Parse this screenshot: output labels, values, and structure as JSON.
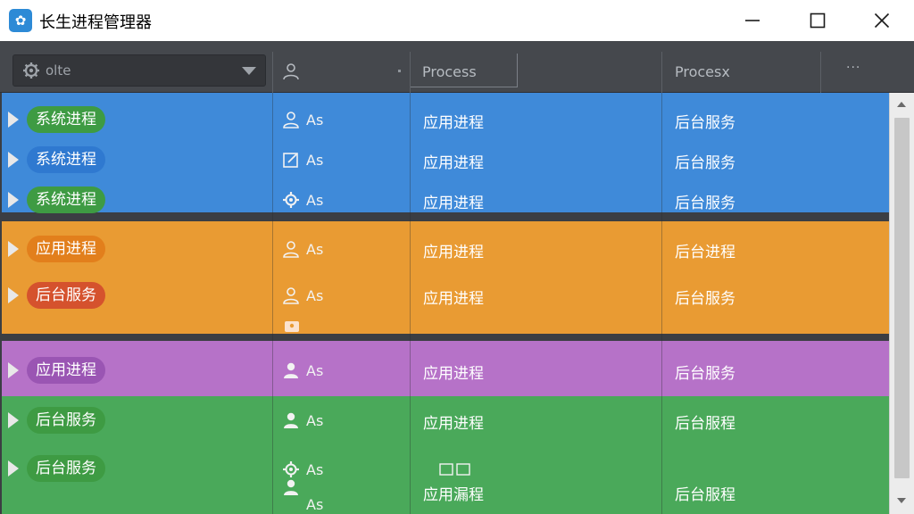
{
  "window": {
    "title": "长生进程管理器",
    "icon": "flower-app-icon",
    "accent": "#2d8ad6"
  },
  "header": {
    "filter_value": "olte",
    "process_label": "Process",
    "procesx_label": "Procesx",
    "more_label": "···"
  },
  "colors": {
    "blue_band": "#3f8ad9",
    "orange_band": "#e99b33",
    "purple_band": "#b672c8",
    "green_band": "#4aa95a",
    "pill_green": "#3e9b43",
    "pill_blue": "#2f79d0",
    "pill_orange": "#e27f1c",
    "pill_red": "#d5522d",
    "pill_purple": "#9a55b3"
  },
  "rows": [
    {
      "tag": "系统进程",
      "user_icon": "user-badge-icon",
      "user": "As",
      "col1": "应用进程",
      "col2": "后台服务"
    },
    {
      "tag": "系统进程",
      "user_icon": "edit-icon",
      "user": "As",
      "col1": "应用进程",
      "col2": "后台服务"
    },
    {
      "tag": "系统进程",
      "user_icon": "gear-icon",
      "user": "As",
      "col1": "应用进程",
      "col2": "后台服务"
    },
    {
      "tag": "应用进程",
      "user_icon": "user-outline-icon",
      "user": "As",
      "col1": "应用进程",
      "col2": "后台进程"
    },
    {
      "tag": "后台服务",
      "user_icon": "user-outline-icon",
      "user": "As",
      "col1": "应用进程",
      "col2": "后台服务"
    },
    {
      "tag": "应用进程",
      "user_icon": "user-filled-icon",
      "user": "As",
      "col1": "应用进程",
      "col2": "后台服务"
    },
    {
      "tag": "后台服务",
      "user_icon": "user-filled-icon",
      "user": "As",
      "col1": "应用进程",
      "col2": "后台服程"
    },
    {
      "tag": "后台服务",
      "user_icon": "gear-icon",
      "user": "As",
      "col1": "应用漏程",
      "col2": "后台服程"
    }
  ],
  "extra_user": "As"
}
